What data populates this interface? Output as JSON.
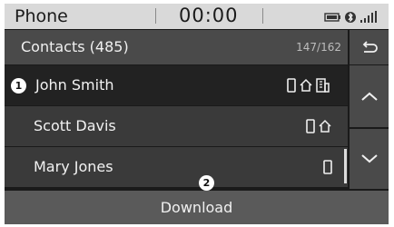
{
  "status_bar": {
    "app_name": "Phone",
    "clock": "00:00",
    "icons": [
      "battery-icon",
      "bluetooth-icon",
      "signal-icon"
    ]
  },
  "header": {
    "title": "Contacts (485)",
    "range": "147/162",
    "back_icon": "back-arrow-icon"
  },
  "contacts": [
    {
      "name": "John Smith",
      "number_types": [
        "mobile-icon",
        "home-icon",
        "office-icon"
      ],
      "selected": true
    },
    {
      "name": "Scott Davis",
      "number_types": [
        "mobile-icon",
        "home-icon"
      ],
      "selected": false
    },
    {
      "name": "Mary Jones",
      "number_types": [
        "mobile-icon"
      ],
      "selected": false
    }
  ],
  "callouts": {
    "one": "1",
    "two": "2"
  },
  "side_buttons": {
    "up_icon": "chevron-up-icon",
    "down_icon": "chevron-down-icon"
  },
  "download_label": "Download",
  "colors": {
    "status_bar_bg": "#d9d9d9",
    "header_bg": "#4a4a4a",
    "selected_row_bg": "#222222",
    "row_bg": "#3a3a3a",
    "download_bg": "#5a5a5a"
  }
}
